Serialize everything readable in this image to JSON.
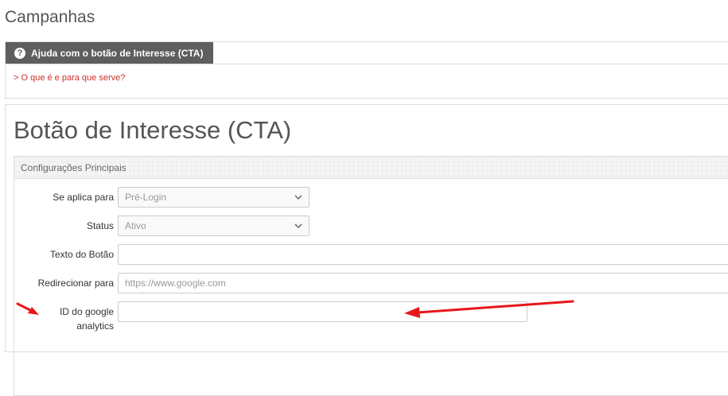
{
  "page": {
    "title": "Campanhas"
  },
  "help": {
    "tab_label": "Ajuda com o botão de Interesse (CTA)",
    "icon": "question-circle-icon",
    "link": "> O que é e para que serve?"
  },
  "main": {
    "title": "Botão de Interesse (CTA)",
    "config_header": "Configurações Principais",
    "fields": {
      "applies_to": {
        "label": "Se aplica para",
        "value": "Pré-Login"
      },
      "status": {
        "label": "Status",
        "value": "Ativo"
      },
      "button_text": {
        "label": "Texto do Botão",
        "value": ""
      },
      "redirect": {
        "label": "Redirecionar para",
        "placeholder": "https://www.google.com"
      },
      "ga_id": {
        "label_line1": "ID do google",
        "label_line2": "analytics",
        "value": ""
      }
    }
  },
  "colors": {
    "tab_bg": "#5e5e5e",
    "link": "#c9302c",
    "annotation_arrow": "#e8161b"
  }
}
